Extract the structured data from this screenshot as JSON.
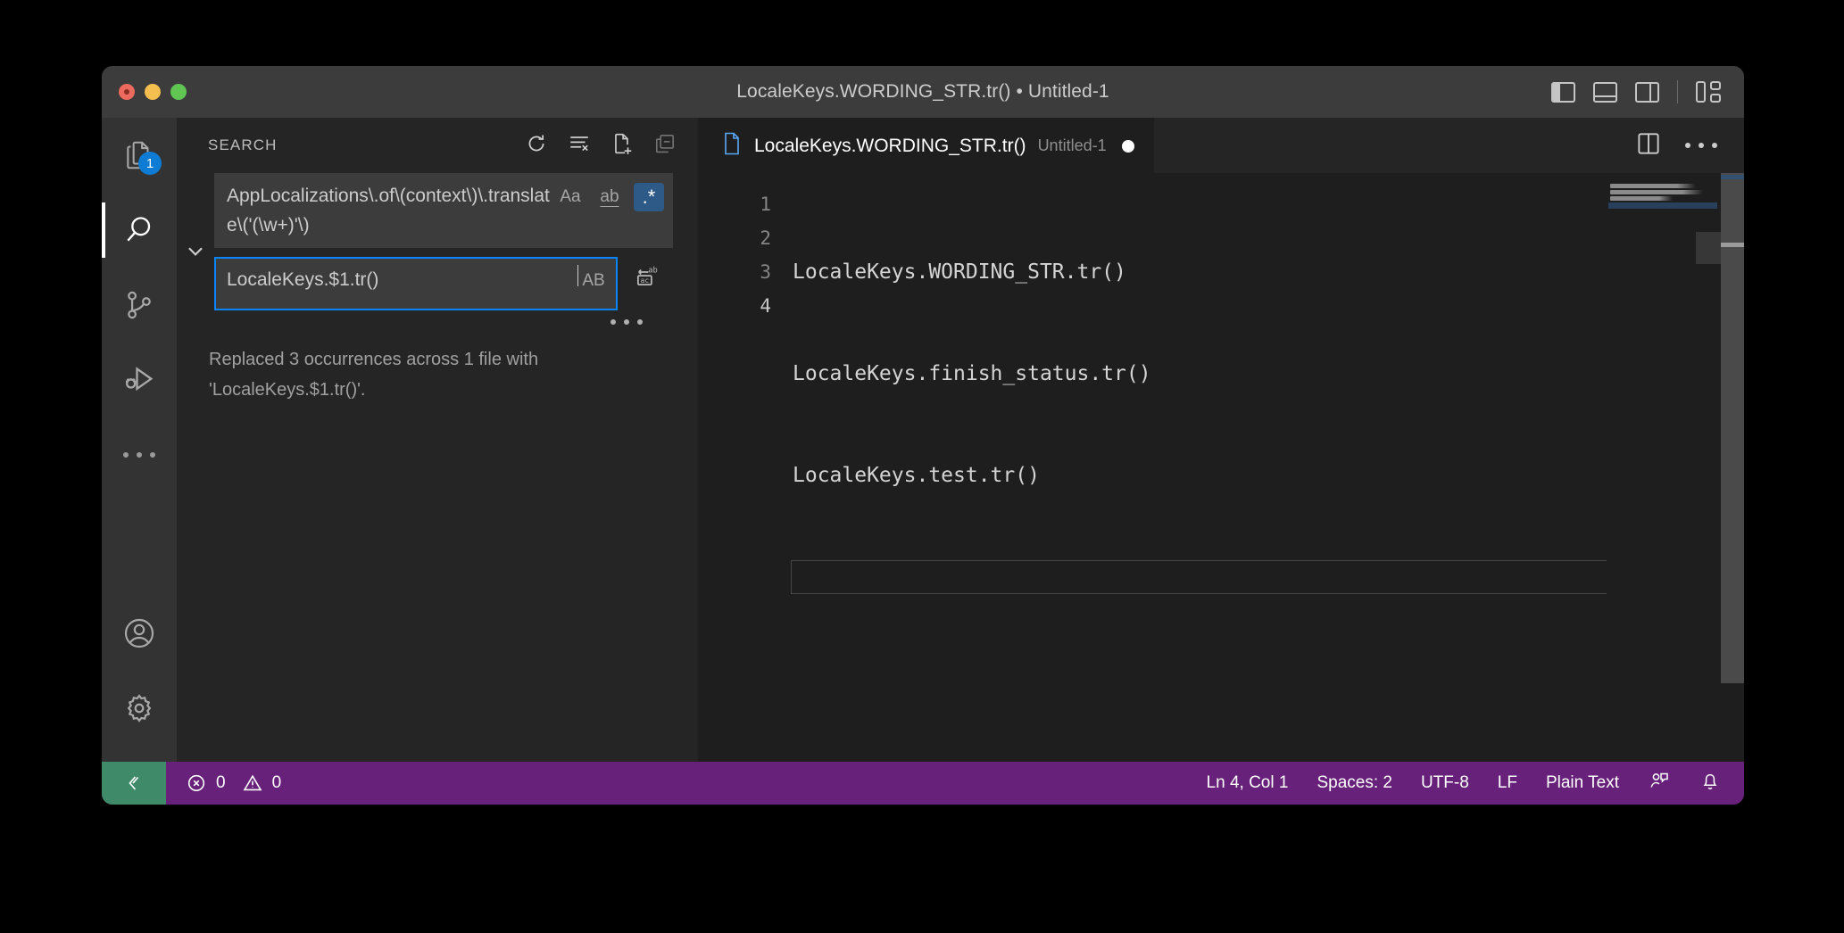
{
  "window": {
    "title": "LocaleKeys.WORDING_STR.tr() • Untitled-1",
    "traffic": {
      "close": "close-window",
      "minimize": "minimize-window",
      "zoom": "zoom-window"
    },
    "layout_controls": [
      {
        "name": "toggle-primary-sidebar",
        "label": "Toggle Primary Side Bar",
        "active": true
      },
      {
        "name": "toggle-panel",
        "label": "Toggle Panel",
        "active": false
      },
      {
        "name": "toggle-secondary-sidebar",
        "label": "Toggle Secondary Side Bar",
        "active": false
      },
      {
        "name": "customize-layout",
        "label": "Customize Layout",
        "active": false
      }
    ]
  },
  "activitybar": {
    "items": [
      {
        "name": "explorer",
        "label": "Explorer",
        "icon": "files-icon",
        "badge": "1",
        "active": false
      },
      {
        "name": "search",
        "label": "Search",
        "icon": "search-icon",
        "badge": "",
        "active": true
      },
      {
        "name": "source-control",
        "label": "Source Control",
        "icon": "source-control-icon",
        "badge": "",
        "active": false
      },
      {
        "name": "run-debug",
        "label": "Run and Debug",
        "icon": "run-debug-icon",
        "badge": "",
        "active": false
      },
      {
        "name": "additional-views",
        "label": "Additional Views",
        "icon": "ellipsis-icon",
        "badge": "",
        "active": false
      }
    ],
    "bottom": [
      {
        "name": "accounts",
        "label": "Accounts",
        "icon": "account-icon"
      },
      {
        "name": "manage",
        "label": "Manage",
        "icon": "gear-icon"
      }
    ]
  },
  "sidebar": {
    "title": "SEARCH",
    "actions": [
      {
        "name": "refresh",
        "label": "Refresh",
        "icon": "refresh-icon",
        "dimmed": false
      },
      {
        "name": "clear-search-results",
        "label": "Clear Search Results",
        "icon": "clear-all-icon",
        "dimmed": false
      },
      {
        "name": "open-new-search-editor",
        "label": "Open New Search Editor",
        "icon": "new-file-icon",
        "dimmed": false
      },
      {
        "name": "collapse-all",
        "label": "Collapse All",
        "icon": "collapse-all-icon",
        "dimmed": true
      }
    ],
    "toggle_replace": {
      "name": "toggle-replace",
      "icon": "chevron-down-icon",
      "expanded": true
    },
    "search": {
      "value": "AppLocalizations\\.of\\(context\\)\\.translate\\('(\\w+)'\\)",
      "placeholder": "Search",
      "options": [
        {
          "name": "match-case",
          "label": "Aa",
          "title": "Match Case",
          "active": false
        },
        {
          "name": "match-whole-word",
          "label": "ab",
          "title": "Match Whole Word",
          "active": false
        },
        {
          "name": "use-regular-expression",
          "label": ".*",
          "title": "Use Regular Expression",
          "active": true
        }
      ]
    },
    "replace": {
      "value": "LocaleKeys.$1.tr()",
      "placeholder": "Replace",
      "preserve_case": {
        "name": "preserve-case",
        "label": "AB",
        "title": "Preserve Case",
        "active": false
      },
      "replace_all": {
        "name": "replace-all",
        "title": "Replace All",
        "icon": "replace-all-icon"
      }
    },
    "toggle_details": {
      "name": "toggle-search-details",
      "icon": "ellipsis-icon",
      "title": "Toggle Search Details"
    },
    "result_message": "Replaced 3 occurrences across 1 file with 'LocaleKeys.$1.tr()'."
  },
  "editor": {
    "tab": {
      "label": "LocaleKeys.WORDING_STR.tr()",
      "description": "Untitled-1",
      "dirty": true,
      "icon": "file-icon"
    },
    "tab_actions": [
      {
        "name": "split-editor-right",
        "label": "Split Editor Right",
        "icon": "split-editor-icon"
      },
      {
        "name": "more-actions",
        "label": "More Actions...",
        "icon": "ellipsis-icon"
      }
    ],
    "line_numbers": [
      "1",
      "2",
      "3",
      "4"
    ],
    "active_line": 4,
    "lines": [
      "LocaleKeys.WORDING_STR.tr()",
      "LocaleKeys.finish_status.tr()",
      "LocaleKeys.test.tr()",
      ""
    ]
  },
  "statusbar": {
    "remote": {
      "name": "remote-window",
      "icon": "remote-icon",
      "color": "#3f8b69"
    },
    "problems": {
      "errors": "0",
      "warnings": "0",
      "error_icon": "error-icon",
      "warning_icon": "warning-icon"
    },
    "right_items": [
      {
        "name": "editor-position",
        "label": "Ln 4, Col 1"
      },
      {
        "name": "editor-indentation",
        "label": "Spaces: 2"
      },
      {
        "name": "editor-encoding",
        "label": "UTF-8"
      },
      {
        "name": "editor-eol",
        "label": "LF"
      },
      {
        "name": "editor-language",
        "label": "Plain Text"
      }
    ],
    "right_icons": [
      {
        "name": "feedback-icon",
        "label": "Tweet Feedback"
      },
      {
        "name": "notifications-bell-icon",
        "label": "No Notifications"
      }
    ],
    "background": "#68217a"
  }
}
